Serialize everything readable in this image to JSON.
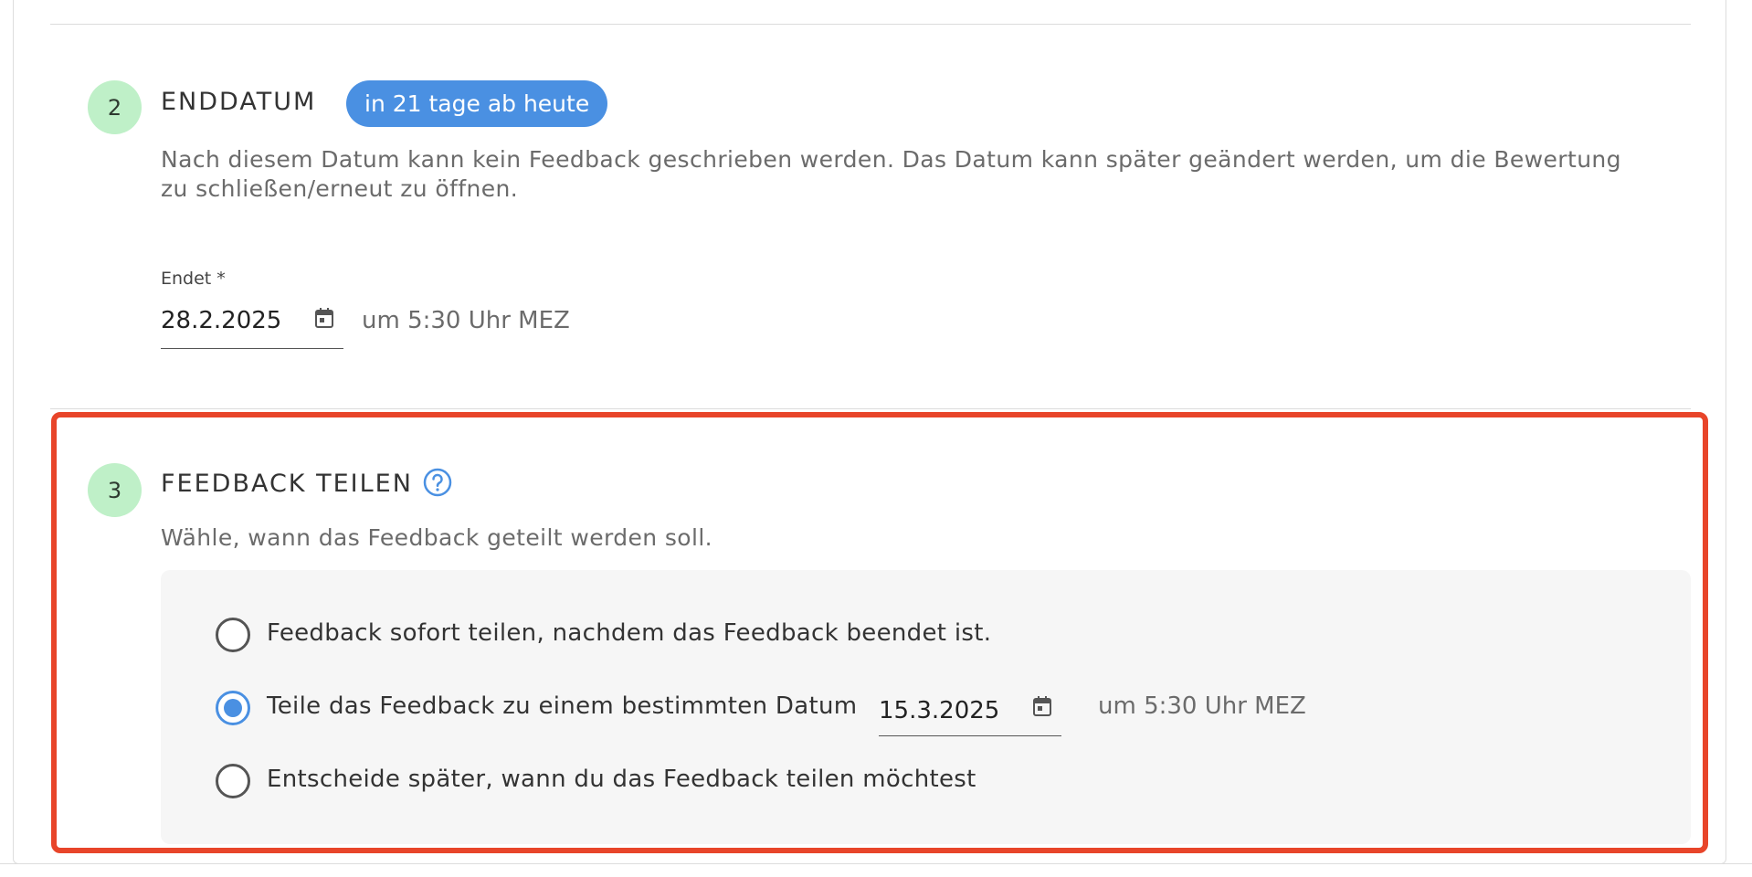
{
  "step2": {
    "number": "2",
    "title": "ENDDATUM",
    "badge": "in 21 tage ab heute",
    "description_line1": "Nach diesem Datum kann kein Feedback geschrieben werden. Das Datum kann später geändert werden, um die Bewertung",
    "description_line2": "zu schließen/erneut zu öffnen.",
    "field_label": "Endet *",
    "date_value": "28.2.2025",
    "time_text": "um 5:30 Uhr MEZ",
    "icon": "calendar-icon"
  },
  "step3": {
    "number": "3",
    "title": "FEEDBACK TEILEN",
    "help_icon": "help-circle-icon",
    "description": "Wähle, wann das Feedback geteilt werden soll.",
    "options": [
      {
        "label": "Feedback sofort teilen, nachdem das Feedback beendet ist.",
        "checked": false
      },
      {
        "label": "Teile das Feedback zu einem bestimmten Datum",
        "checked": true
      },
      {
        "label": "Entscheide später, wann du das Feedback teilen möchtest",
        "checked": false
      }
    ],
    "share_date_value": "15.3.2025",
    "share_time_text": "um 5:30 Uhr MEZ"
  },
  "colors": {
    "accent": "#4a90e2",
    "step_circle": "#bff0c8",
    "highlight_border": "#e8452a"
  }
}
